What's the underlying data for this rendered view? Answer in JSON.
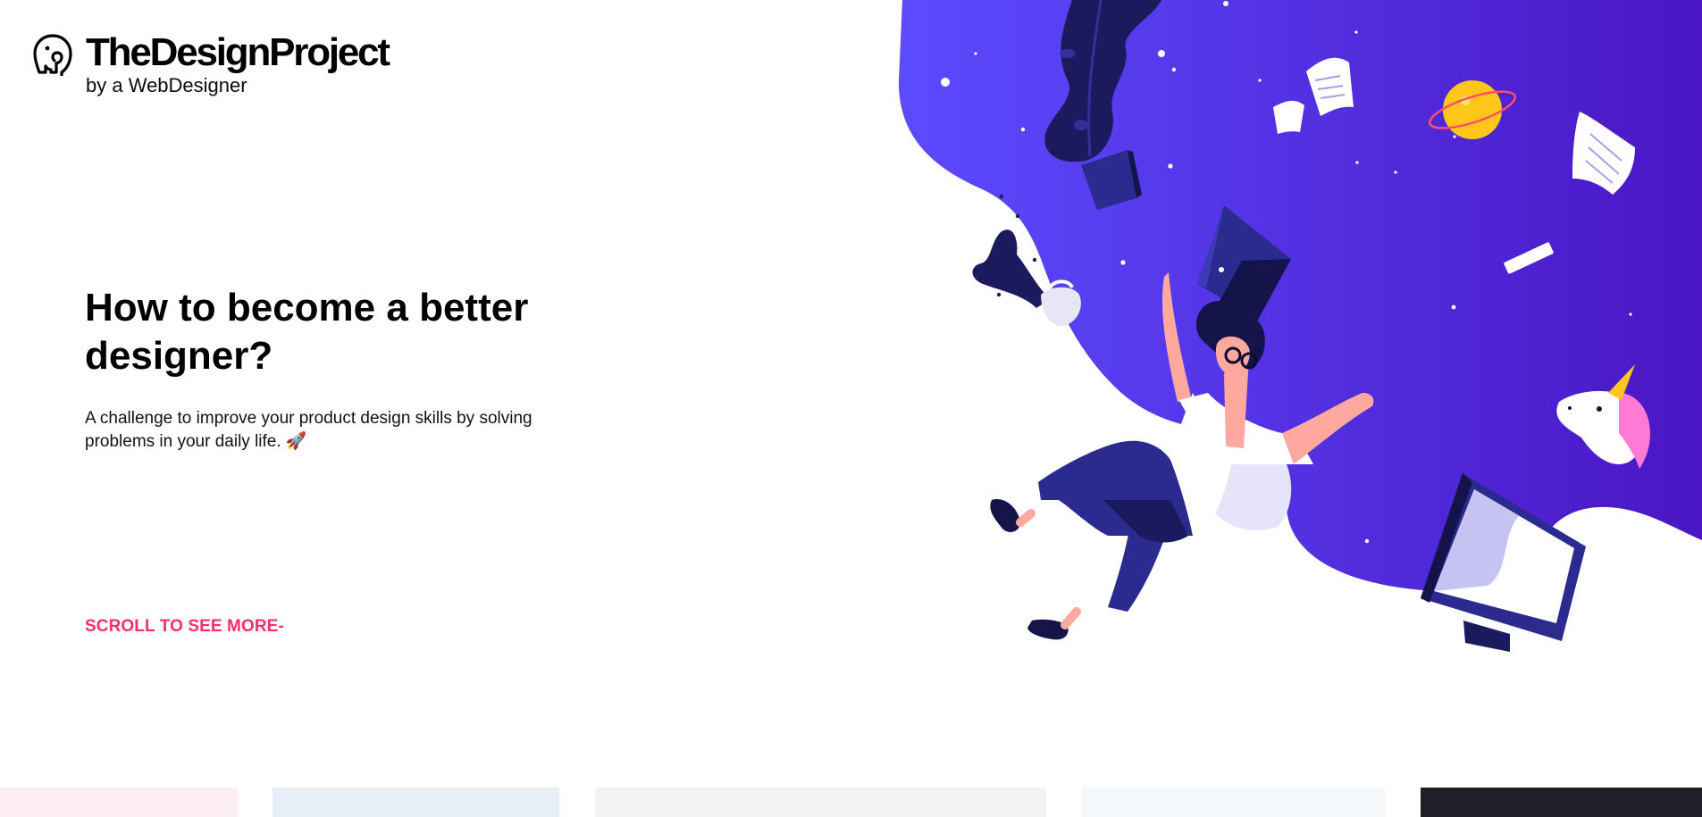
{
  "brand": {
    "title": "TheDesignProject",
    "subtitle": "by a WebDesigner",
    "logo_icon": "elephant-logo-icon"
  },
  "hero": {
    "heading": "How to become a better designer?",
    "description": "A challenge to improve your product design skills by solving problems in your daily life. 🚀",
    "scroll_link": "SCROLL TO SEE MORE-",
    "illustration": "falling-designer-illustration"
  },
  "colors": {
    "accent": "#FF2D6F",
    "illustration_purple_start": "#5C4BFF",
    "illustration_purple_end": "#4A16C4",
    "text": "#000000",
    "card_pink": "#FDEEF1",
    "card_blue": "#E7EEF7",
    "card_gray": "#F3F3F3",
    "card_light": "#F4F8FC",
    "card_dark": "#1E1F2B"
  },
  "cards": [
    {
      "name": "card-pink",
      "color": "#FDEEF1"
    },
    {
      "name": "card-blue",
      "color": "#E7EEF7"
    },
    {
      "name": "card-gray",
      "color": "#F3F3F3"
    },
    {
      "name": "card-light",
      "color": "#F4F8FC"
    },
    {
      "name": "card-dark",
      "color": "#1E1F2B"
    }
  ]
}
